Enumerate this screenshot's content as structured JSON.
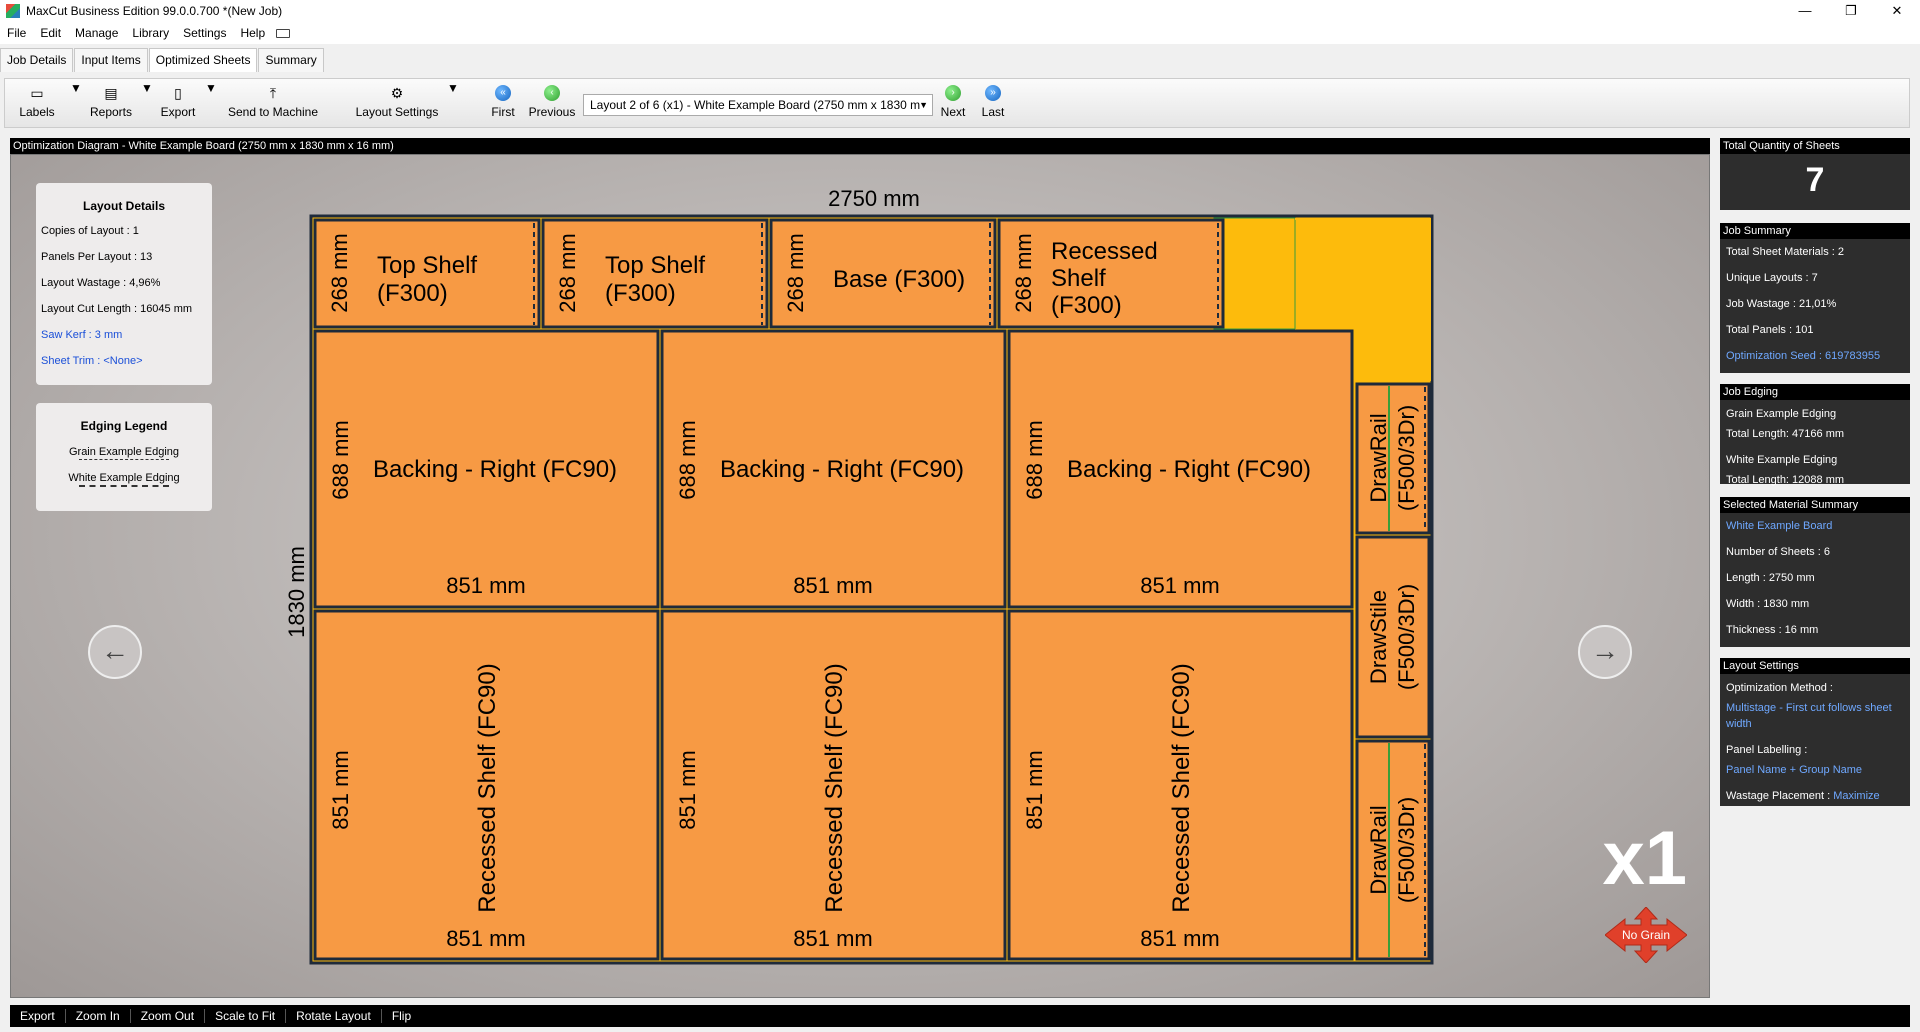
{
  "window": {
    "title": "MaxCut Business Edition 99.0.0.700 *(New Job)",
    "minimize": "—",
    "maximize": "❐",
    "close": "✕"
  },
  "menu": [
    "File",
    "Edit",
    "Manage",
    "Library",
    "Settings",
    "Help"
  ],
  "tabs": [
    "Job Details",
    "Input Items",
    "Optimized Sheets",
    "Summary"
  ],
  "toolbar": {
    "labels": "Labels",
    "reports": "Reports",
    "export": "Export",
    "send_to_machine": "Send to Machine",
    "layout_settings": "Layout Settings",
    "first": "First",
    "previous": "Previous",
    "layout_select": "Layout 2 of 6 (x1) - White Example Board (2750 mm x 1830 m",
    "next": "Next",
    "last": "Last"
  },
  "diagram": {
    "title": "Optimization Diagram - White Example Board (2750 mm x 1830 mm x 16 mm)",
    "sheet_length": "2750 mm",
    "sheet_width": "1830 mm",
    "copies_badge": "x1",
    "grain_badge": "No Grain"
  },
  "layout_details": {
    "header": "Layout Details",
    "copies": "Copies of Layout :  1",
    "panels": "Panels Per Layout :  13",
    "wastage": "Layout Wastage :  4,96%",
    "cut_length": "Layout Cut Length :  16045 mm",
    "saw_kerf": "Saw Kerf :  3 mm",
    "sheet_trim": "Sheet Trim :  <None>"
  },
  "edging_legend": {
    "header": "Edging Legend",
    "grain": "Grain Example Edging",
    "white": "White Example Edging"
  },
  "panels": {
    "top_shelf_name": "Top Shelf",
    "top_shelf_group": "(F300)",
    "top_dim": "268 mm",
    "base": "Base (F300)",
    "recessed1": "Recessed",
    "recessed2": "Shelf",
    "recessed3": "(F300)",
    "backing": "Backing - Right (FC90)",
    "backing_h": "688 mm",
    "width_851": "851 mm",
    "recessed_fc90": "Recessed Shelf (FC90)",
    "drawrail1": "DrawRail",
    "drawrail2": "(F500/3Dr)",
    "drawstile1": "DrawStile",
    "drawstile2": "(F500/3Dr)"
  },
  "right": {
    "total_qty_hdr": "Total Quantity of Sheets",
    "total_qty": "7",
    "job_summary_hdr": "Job Summary",
    "total_sheet_materials": "Total Sheet Materials :  2",
    "unique_layouts": "Unique Layouts :  7",
    "job_wastage": "Job Wastage :  21,01%",
    "total_panels": "Total Panels :  101",
    "optimization_seed": "Optimization Seed :  619783955",
    "job_edging_hdr": "Job Edging",
    "grain_edging": "Grain Example Edging",
    "grain_total": "Total Length: 47166 mm",
    "white_edging": "White Example Edging",
    "white_total": "Total Length: 12088 mm",
    "selected_hdr": "Selected Material Summary",
    "material": "White Example Board",
    "num_sheets": "Number of Sheets :  6",
    "length": "Length :  2750 mm",
    "width": "Width :  1830 mm",
    "thickness": "Thickness :  16 mm",
    "layout_settings_hdr": "Layout Settings",
    "opt_method_label": "Optimization Method :",
    "opt_method_value": "Multistage - First cut follows sheet width",
    "panel_labelling_label": "Panel Labelling :",
    "panel_labelling_value": "Panel Name + Group Name",
    "wastage_placement_label": "Wastage Placement :",
    "wastage_placement_value": "Maximize"
  },
  "bottom": [
    "Export",
    "Zoom In",
    "Zoom Out",
    "Scale to Fit",
    "Rotate Layout",
    "Flip"
  ],
  "colors": {
    "panel": "#f79a44",
    "waste": "#fdbb0c",
    "sheet_border": "#1e2a3a",
    "link": "#1a4fd8"
  }
}
